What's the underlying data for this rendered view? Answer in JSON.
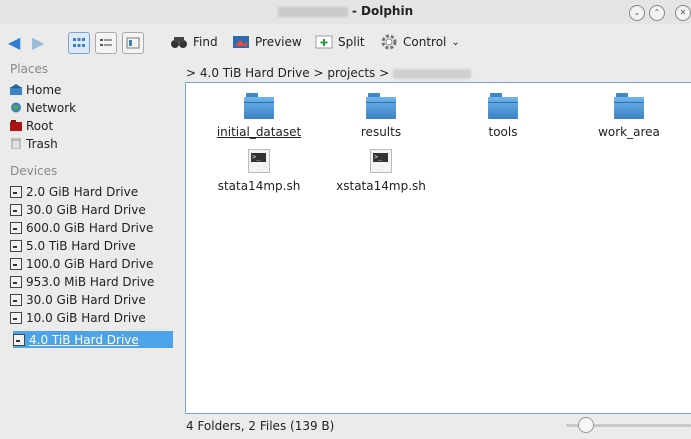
{
  "window": {
    "title_suffix": "- Dolphin",
    "minimize_symbol": "⌄",
    "maximize_symbol": "⌃",
    "close_symbol": "✕"
  },
  "toolbar": {
    "back_symbol": "◀",
    "forward_symbol": "▶",
    "find_label": "Find",
    "preview_label": "Preview",
    "split_label": "Split",
    "control_label": "Control",
    "control_arrow": "⌄"
  },
  "sidebar": {
    "places_title": "Places",
    "places": [
      {
        "label": "Home"
      },
      {
        "label": "Network"
      },
      {
        "label": "Root"
      },
      {
        "label": "Trash"
      }
    ],
    "devices_title": "Devices",
    "devices": [
      {
        "label": "2.0 GiB Hard Drive"
      },
      {
        "label": "30.0 GiB Hard Drive"
      },
      {
        "label": "600.0 GiB Hard Drive"
      },
      {
        "label": "5.0 TiB Hard Drive"
      },
      {
        "label": "100.0 GiB Hard Drive"
      },
      {
        "label": "953.0 MiB Hard Drive"
      },
      {
        "label": "30.0 GiB Hard Drive"
      },
      {
        "label": "10.0 GiB Hard Drive"
      },
      {
        "label": "4.0 TiB Hard Drive"
      }
    ]
  },
  "breadcrumb": {
    "arrow": ">",
    "segments": [
      "4.0 TiB Hard Drive",
      "projects"
    ]
  },
  "files": [
    {
      "name": "initial_dataset",
      "type": "folder"
    },
    {
      "name": "results",
      "type": "folder"
    },
    {
      "name": "tools",
      "type": "folder"
    },
    {
      "name": "work_area",
      "type": "folder"
    },
    {
      "name": "stata14mp.sh",
      "type": "script"
    },
    {
      "name": "xstata14mp.sh",
      "type": "script"
    }
  ],
  "script_glyph": ">_",
  "status": {
    "text": "4 Folders, 2 Files (139 B)",
    "zoom_fraction": 0.12
  },
  "colors": {
    "selection": "#4da3e8",
    "folder": "#3a82c4",
    "view_border": "#7aa3cf"
  }
}
